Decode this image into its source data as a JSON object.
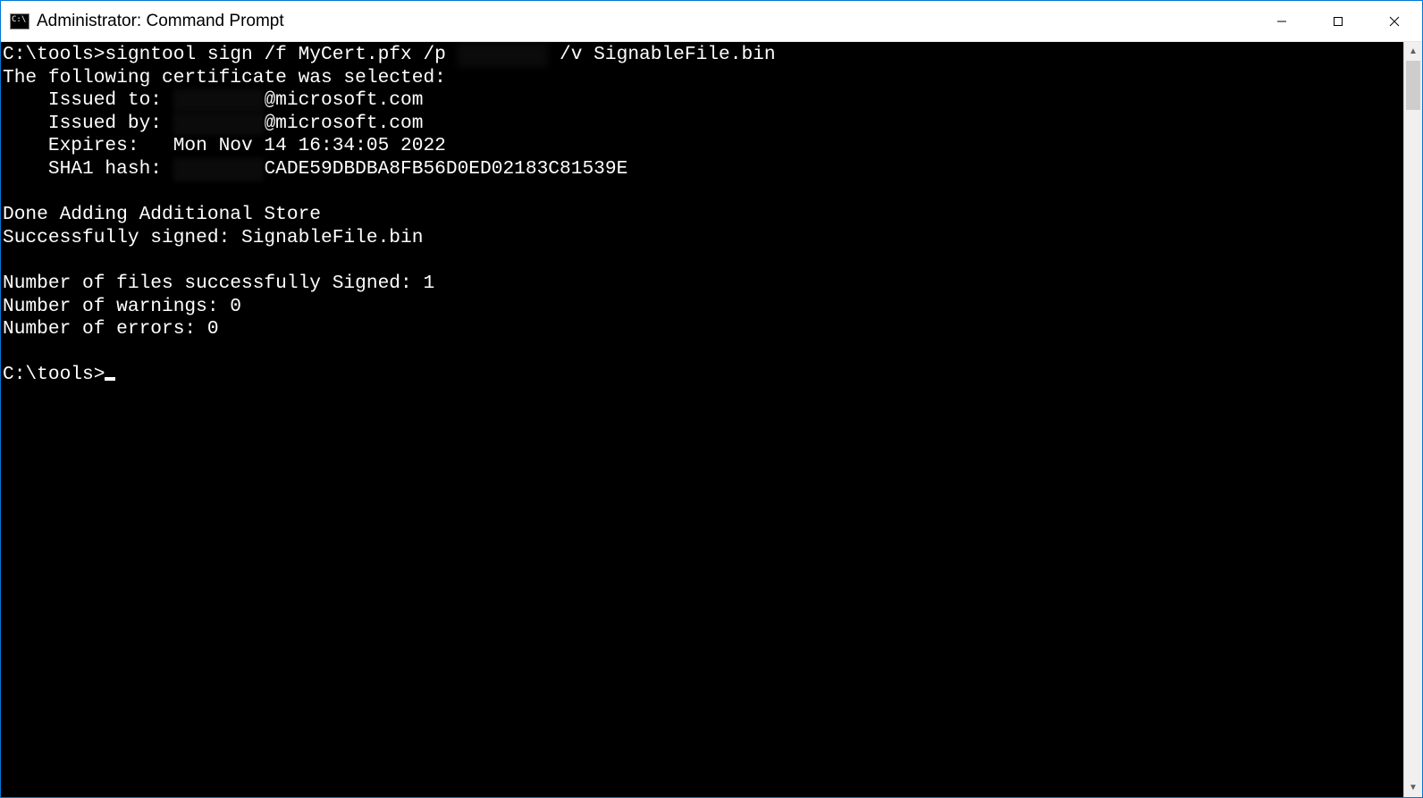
{
  "window": {
    "title": "Administrator: Command Prompt"
  },
  "terminal": {
    "prompt1": "C:\\tools>",
    "cmd_pre": "signtool sign /f MyCert.pfx /p ",
    "cmd_redacted": "████████",
    "cmd_post": " /v SignableFile.bin",
    "line_selected": "The following certificate was selected:",
    "issued_to_label": "    Issued to: ",
    "issued_to_redacted": "████████",
    "issued_to_suffix": "@microsoft.com",
    "issued_by_label": "    Issued by: ",
    "issued_by_redacted": "████████",
    "issued_by_suffix": "@microsoft.com",
    "expires": "    Expires:   Mon Nov 14 16:34:05 2022",
    "sha1_label": "    SHA1 hash: ",
    "sha1_redacted": "████████",
    "sha1_suffix": "CADE59DBDBA8FB56D0ED02183C81539E",
    "done_store": "Done Adding Additional Store",
    "success_signed": "Successfully signed: SignableFile.bin",
    "num_signed": "Number of files successfully Signed: 1",
    "num_warnings": "Number of warnings: 0",
    "num_errors": "Number of errors: 0",
    "prompt2": "C:\\tools>"
  }
}
